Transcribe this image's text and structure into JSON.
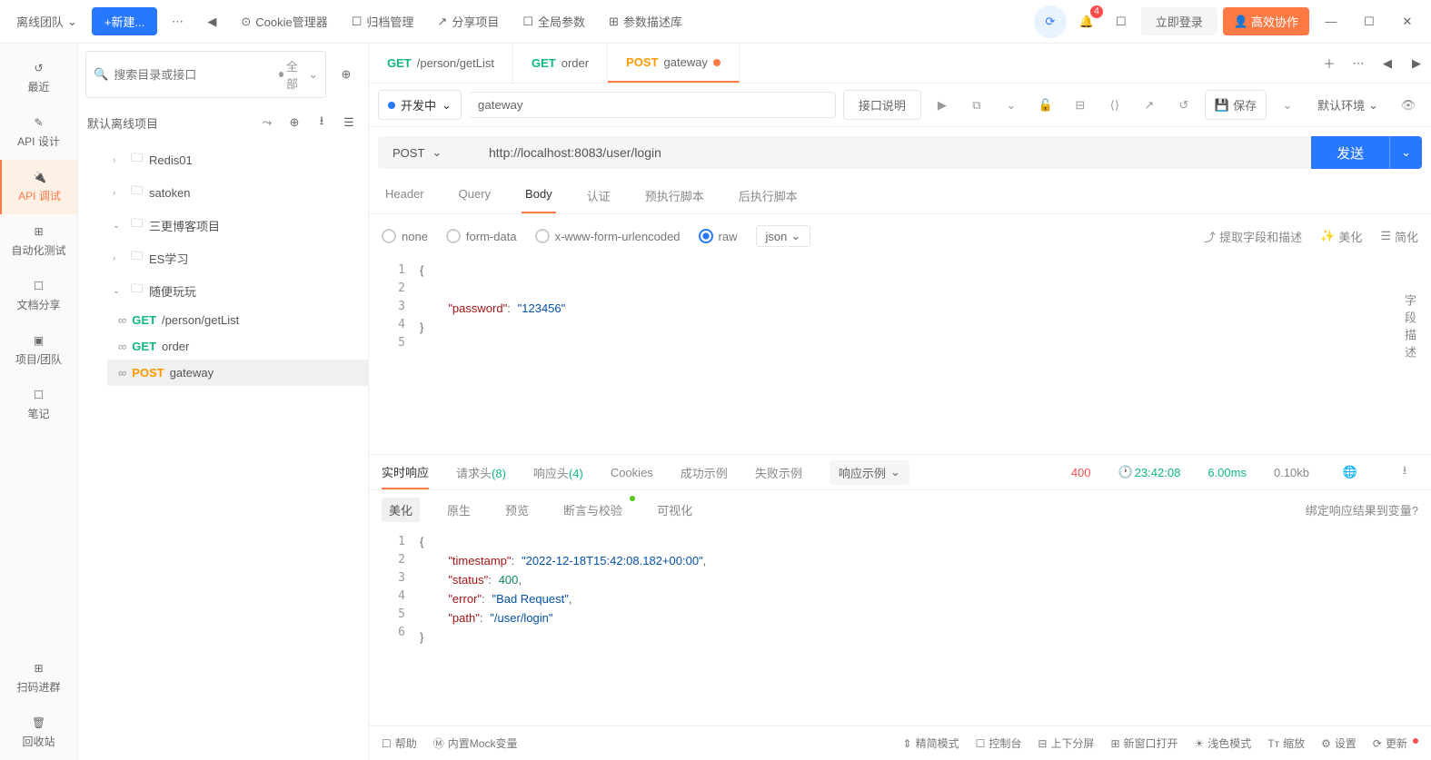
{
  "topbar": {
    "team": "离线团队",
    "new_btn": "+新建...",
    "cookie_mgr": "Cookie管理器",
    "archive": "归档管理",
    "share": "分享项目",
    "global_params": "全局参数",
    "param_desc": "参数描述库",
    "notif_count": "4",
    "login": "立即登录",
    "collab": "高效协作"
  },
  "sidebar": {
    "recent": "最近",
    "design": "API 设计",
    "debug": "API 调试",
    "auto_test": "自动化测试",
    "doc_share": "文档分享",
    "project_team": "项目/团队",
    "notes": "笔记",
    "scan_group": "扫码进群",
    "recycle": "回收站"
  },
  "tree": {
    "search_placeholder": "搜索目录或接口",
    "filter": "全部",
    "project": "默认离线项目",
    "folders": [
      {
        "name": "Redis01",
        "expanded": false
      },
      {
        "name": "satoken",
        "expanded": false
      },
      {
        "name": "三更博客项目",
        "expanded": false
      },
      {
        "name": "ES学习",
        "expanded": false
      },
      {
        "name": "随便玩玩",
        "expanded": true,
        "apis": [
          {
            "method": "GET",
            "name": "/person/getList"
          },
          {
            "method": "GET",
            "name": "order"
          },
          {
            "method": "POST",
            "name": "gateway",
            "selected": true
          }
        ]
      }
    ]
  },
  "tabs": [
    {
      "method": "GET",
      "name": "/person/getList"
    },
    {
      "method": "GET",
      "name": "order"
    },
    {
      "method": "POST",
      "name": "gateway",
      "active": true,
      "dirty": true
    }
  ],
  "toolbar": {
    "status": "开发中",
    "api_name": "gateway",
    "api_desc": "接口说明",
    "save": "保存",
    "env": "默认环境"
  },
  "request": {
    "method": "POST",
    "url": "http://localhost:8083/user/login",
    "send": "发送",
    "tabs": {
      "header": "Header",
      "query": "Query",
      "body": "Body",
      "auth": "认证",
      "pre": "预执行脚本",
      "post": "后执行脚本"
    },
    "body_types": {
      "none": "none",
      "form": "form-data",
      "urlencoded": "x-www-form-urlencoded",
      "raw": "raw"
    },
    "json_type": "json",
    "actions": {
      "extract": "提取字段和描述",
      "beautify": "美化",
      "simplify": "简化"
    },
    "body_lines": [
      "{",
      "",
      "    \"password\": \"123456\"",
      "}",
      ""
    ],
    "field_desc": "字段描述"
  },
  "response": {
    "tabs": {
      "realtime": "实时响应",
      "req_headers": "请求头",
      "req_headers_cnt": "(8)",
      "resp_headers": "响应头",
      "resp_headers_cnt": "(4)",
      "cookies": "Cookies",
      "success": "成功示例",
      "fail": "失败示例",
      "example": "响应示例"
    },
    "status": "400",
    "time": "23:42:08",
    "duration": "6.00ms",
    "size": "0.10kb",
    "subtabs": {
      "beautify": "美化",
      "raw": "原生",
      "preview": "预览",
      "assert": "断言与校验",
      "viz": "可视化"
    },
    "bind": "绑定响应结果到变量?",
    "body_lines": [
      "{",
      "    \"timestamp\": \"2022-12-18T15:42:08.182+00:00\",",
      "    \"status\": 400,",
      "    \"error\": \"Bad Request\",",
      "    \"path\": \"/user/login\"",
      "}"
    ]
  },
  "bottombar": {
    "help": "帮助",
    "mock": "内置Mock变量",
    "compact": "精简模式",
    "console": "控制台",
    "split": "上下分屏",
    "newwin": "新窗口打开",
    "light": "浅色模式",
    "zoom": "缩放",
    "settings": "设置",
    "update": "更新"
  }
}
